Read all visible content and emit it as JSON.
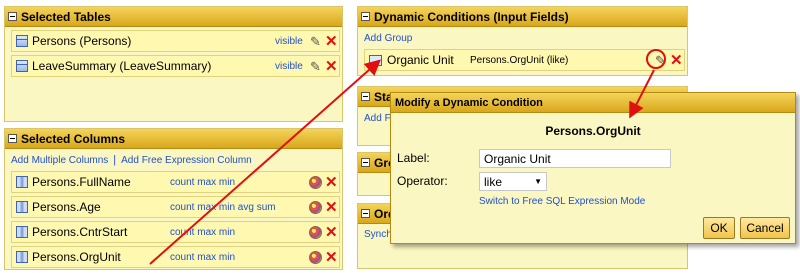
{
  "selected_tables": {
    "title": "Selected Tables",
    "rows": [
      {
        "label": "Persons (Persons)",
        "visibility": "visible"
      },
      {
        "label": "LeaveSummary (LeaveSummary)",
        "visibility": "visible"
      }
    ]
  },
  "selected_columns": {
    "title": "Selected Columns",
    "add_multiple": "Add Multiple Columns",
    "separator": "|",
    "add_free_expression": "Add Free Expression Column",
    "rows": [
      {
        "label": "Persons.FullName",
        "aggregates": "count max min"
      },
      {
        "label": "Persons.Age",
        "aggregates": "count max min avg sum"
      },
      {
        "label": "Persons.CntrStart",
        "aggregates": "count max min"
      },
      {
        "label": "Persons.OrgUnit",
        "aggregates": "count max min"
      }
    ]
  },
  "dynamic_conditions": {
    "title": "Dynamic Conditions (Input Fields)",
    "add_group": "Add Group",
    "condition": {
      "label": "Organic Unit",
      "field": "Persons.OrgUnit (like)"
    }
  },
  "static_conditions": {
    "title": "Static Conditions",
    "add_link": "Add F"
  },
  "group_panel": {
    "title": "Gro"
  },
  "order_panel": {
    "title": "Ord",
    "link": "Synch"
  },
  "dialog": {
    "title": "Modify a Dynamic Condition",
    "heading": "Persons.OrgUnit",
    "label_caption": "Label:",
    "label_value": "Organic Unit",
    "operator_caption": "Operator:",
    "operator_value": "like",
    "switch_link": "Switch to Free SQL Expression Mode",
    "ok_label": "OK",
    "cancel_label": "Cancel"
  },
  "colors": {
    "panel_bg": "#fbf7c2",
    "header_gold": "#d9a71c",
    "link_blue": "#2150c8",
    "delete_red": "#e01010",
    "annotation_red": "#e01010"
  },
  "icons": [
    "collapse-icon",
    "table-icon",
    "column-icon",
    "pencil-icon",
    "delete-icon",
    "format-icon",
    "dropdown-arrow-icon",
    "input-field-icon"
  ]
}
